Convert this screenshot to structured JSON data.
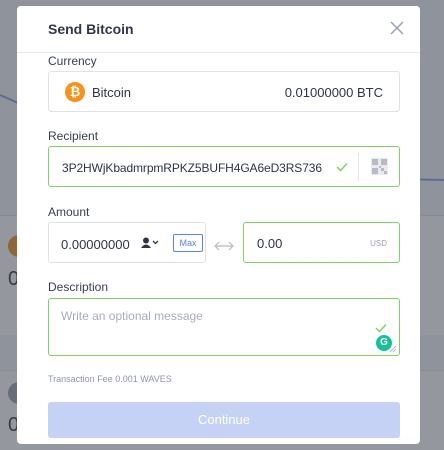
{
  "modal": {
    "title": "Send Bitcoin"
  },
  "currency": {
    "label": "Currency",
    "name": "Bitcoin",
    "icon": "bitcoin-icon",
    "icon_glyph": "₿",
    "balance": "0.01000000 BTC"
  },
  "recipient": {
    "label": "Recipient",
    "value": "3P2HWjKbadmrpmRPKZ5BUFH4GA6eD3RS736"
  },
  "amount": {
    "label": "Amount",
    "value": "0.00000000",
    "max_label": "Max",
    "fiat_value": "0.00",
    "fiat_unit": "USD"
  },
  "description": {
    "label": "Description",
    "placeholder": "Write an optional message",
    "grammarly_glyph": "G"
  },
  "fee": {
    "text": "Transaction Fee 0.001 WAVES"
  },
  "actions": {
    "continue_label": "Continue"
  },
  "background": {
    "digits": [
      "0",
      "0"
    ]
  },
  "colors": {
    "valid_border": "#7ed364",
    "accent": "#5a81ea",
    "bitcoin": "#f7931a",
    "button_disabled": "#c5d1f5"
  }
}
